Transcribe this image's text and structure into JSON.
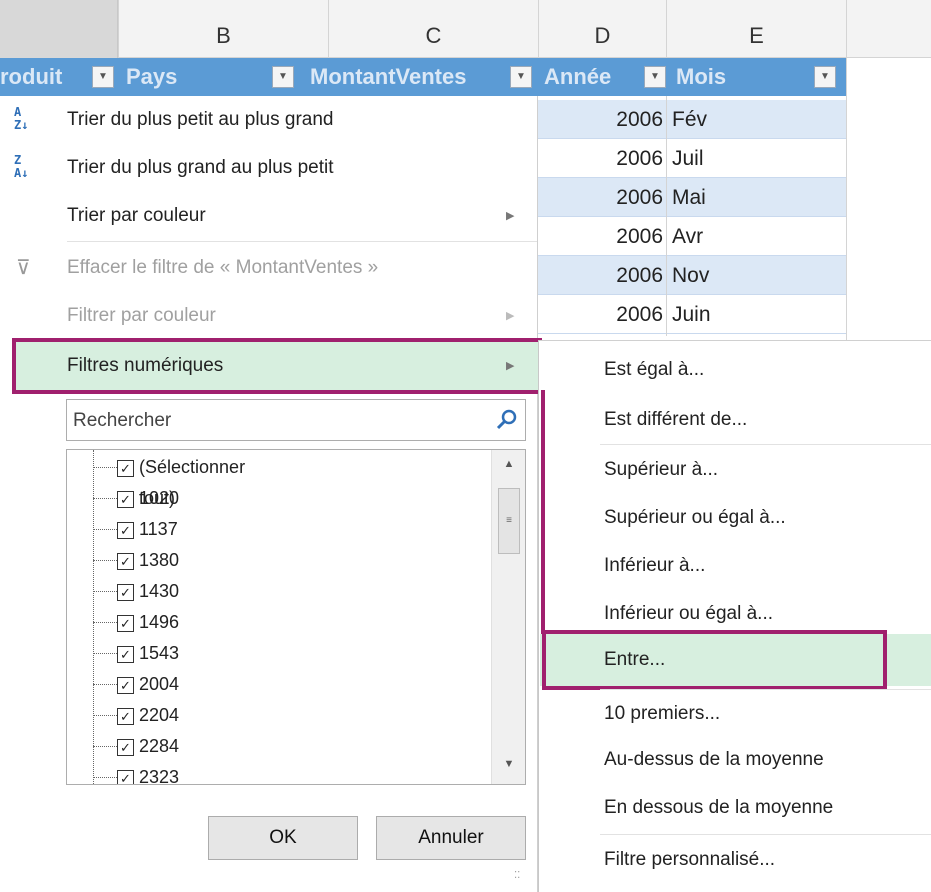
{
  "columns": [
    "B",
    "C",
    "D",
    "E"
  ],
  "table_headers": {
    "produit": "roduit",
    "pays": "Pays",
    "montant": "MontantVentes",
    "annee": "Année",
    "mois": "Mois"
  },
  "rows": [
    {
      "annee": "2006",
      "mois": "Fév"
    },
    {
      "annee": "2006",
      "mois": "Juil"
    },
    {
      "annee": "2006",
      "mois": "Mai"
    },
    {
      "annee": "2006",
      "mois": "Avr"
    },
    {
      "annee": "2006",
      "mois": "Nov"
    },
    {
      "annee": "2006",
      "mois": "Juin"
    }
  ],
  "menu": {
    "sort_asc": "Trier du plus petit au plus grand",
    "sort_desc": "Trier du plus grand au plus petit",
    "sort_color": "Trier par couleur",
    "clear_filter": "Effacer le filtre de « MontantVentes »",
    "filter_color": "Filtrer par couleur",
    "number_filters": "Filtres numériques"
  },
  "search": {
    "placeholder": "Rechercher"
  },
  "list_items": [
    "(Sélectionner tout)",
    "1020",
    "1137",
    "1380",
    "1430",
    "1496",
    "1543",
    "2004",
    "2204",
    "2284",
    "2323"
  ],
  "buttons": {
    "ok": "OK",
    "cancel": "Annuler"
  },
  "submenu": [
    "Est égal à...",
    "Est différent de...",
    "Supérieur à...",
    "Supérieur ou égal à...",
    "Inférieur à...",
    "Inférieur ou égal à...",
    "Entre...",
    "10 premiers...",
    "Au-dessus de la moyenne",
    "En dessous de la moyenne",
    "Filtre personnalisé..."
  ],
  "colors": {
    "highlight_border": "#a0206e",
    "highlight_fill": "#d7efdf",
    "table_header": "#5b9bd5",
    "row_alt": "#dce8f6"
  }
}
